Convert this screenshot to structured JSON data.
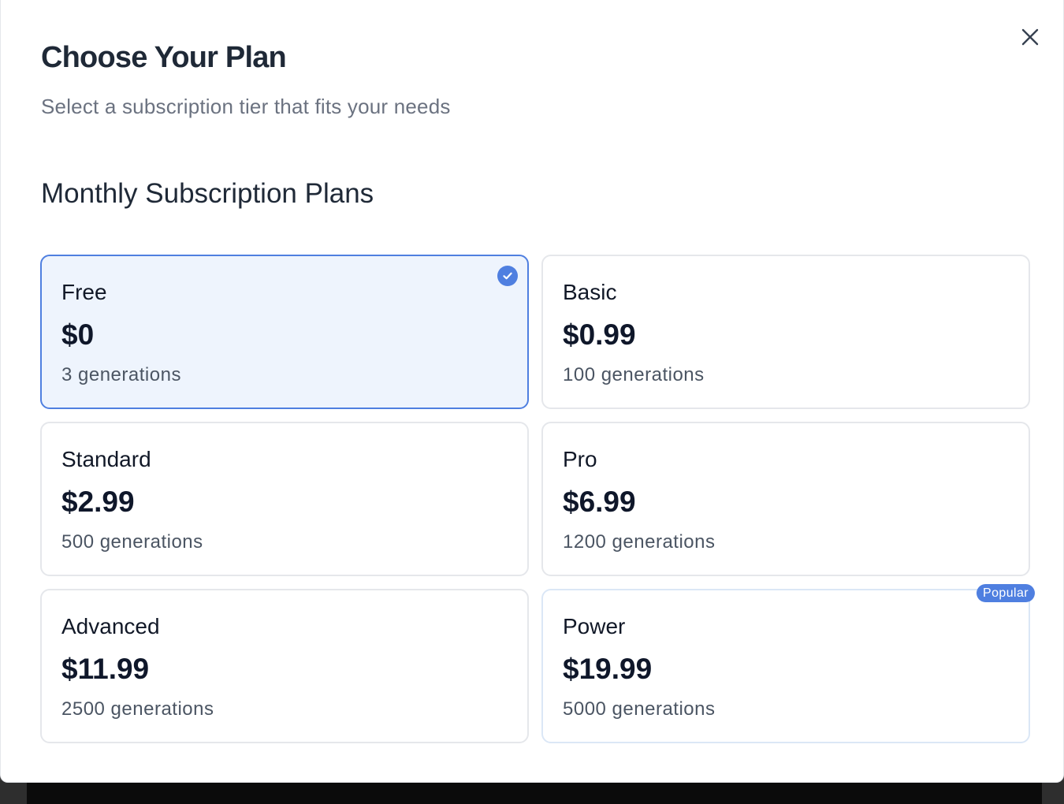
{
  "modal": {
    "title": "Choose Your Plan",
    "subtitle": "Select a subscription tier that fits your needs",
    "section_title": "Monthly Subscription Plans",
    "close_icon": "close-icon"
  },
  "plans": [
    {
      "name": "Free",
      "price": "$0",
      "desc": "3 generations",
      "selected": true
    },
    {
      "name": "Basic",
      "price": "$0.99",
      "desc": "100 generations"
    },
    {
      "name": "Standard",
      "price": "$2.99",
      "desc": "500 generations"
    },
    {
      "name": "Pro",
      "price": "$6.99",
      "desc": "1200 generations"
    },
    {
      "name": "Advanced",
      "price": "$11.99",
      "desc": "2500 generations"
    },
    {
      "name": "Power",
      "price": "$19.99",
      "desc": "5000 generations",
      "badge": "Popular"
    }
  ],
  "colors": {
    "accent": "#4f7fe0",
    "selected_bg": "#eef4fd",
    "title": "#1f2937",
    "muted": "#6b7280"
  }
}
